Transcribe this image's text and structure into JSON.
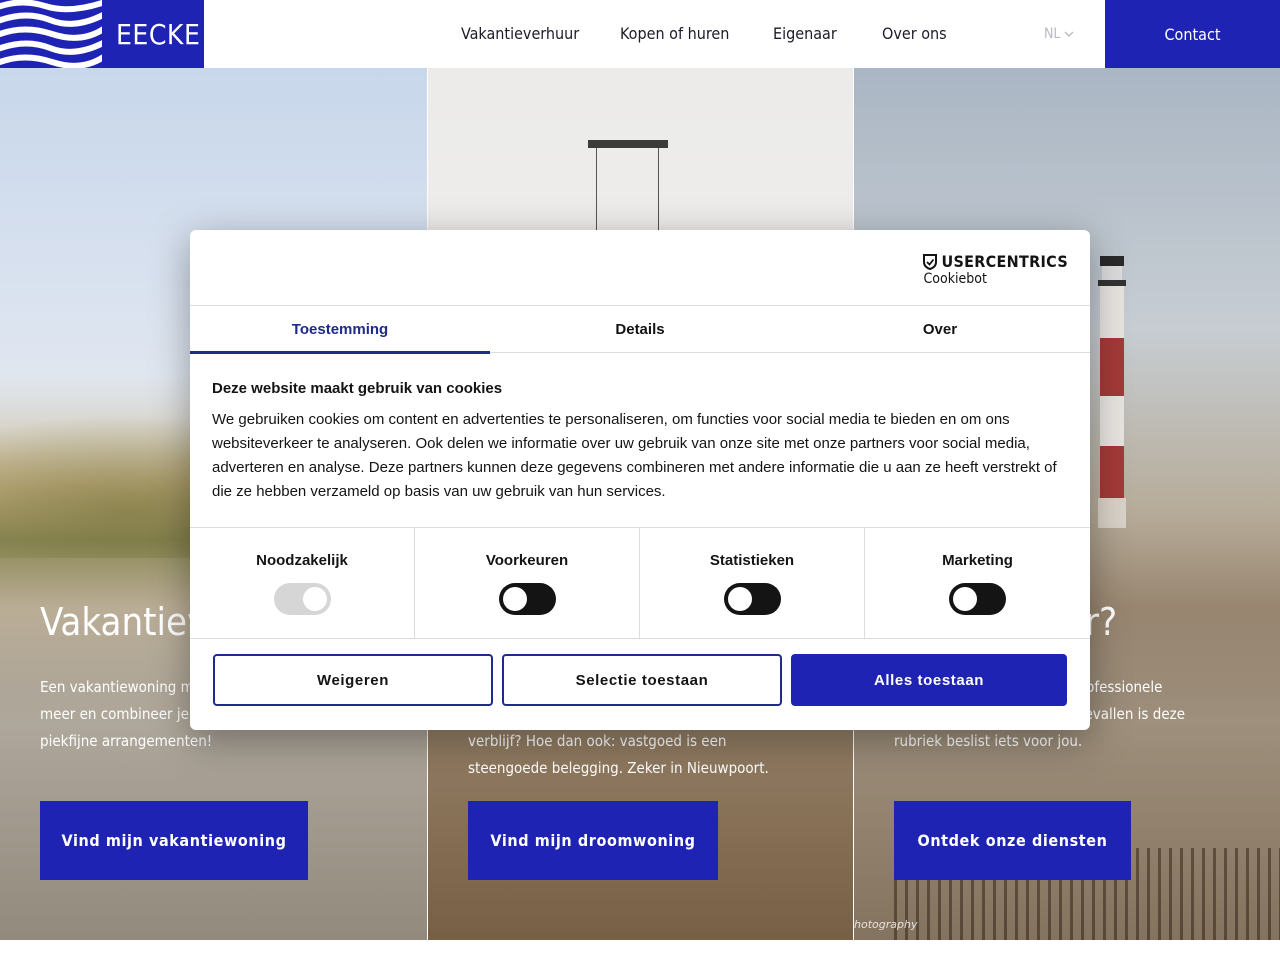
{
  "header": {
    "logo_text": "EECKE",
    "nav": [
      "Vakantieverhuur",
      "Kopen of huren",
      "Eigenaar",
      "Over ons"
    ],
    "language": "NL",
    "contact": "Contact"
  },
  "panels": [
    {
      "title": "Vakantieve",
      "text": "Een vakantiewoning me duinen? Wij hebben het meer en combineer je verblijf met een van onze piekfijne arrangementen!",
      "button": "Vind mijn vakantiewoning"
    },
    {
      "title": "",
      "text": "verblijf? Hoe dan ook: vastgoed is een steengoede belegging. Zeker in Nieuwpoort.",
      "button": "Vind mijn droomwoning"
    },
    {
      "title": "ar?",
      "text": "rd syndicus? Of wil je met professionele begeleiding? Wel, in beide gevallen is deze rubriek beslist iets voor jou.",
      "button": "Ontdek onze diensten"
    }
  ],
  "credit": "hotography",
  "cookie_dialog": {
    "brand_top": "USERCENTRICS",
    "brand_sub": "Cookiebot",
    "tabs": [
      "Toestemming",
      "Details",
      "Over"
    ],
    "active_tab": "Toestemming",
    "heading": "Deze website maakt gebruik van cookies",
    "body": "We gebruiken cookies om content en advertenties te personaliseren, om functies voor social media te bieden en om ons websiteverkeer te analyseren. Ook delen we informatie over uw gebruik van onze site met onze partners voor social media, adverteren en analyse. Deze partners kunnen deze gegevens combineren met andere informatie die u aan ze heeft verstrekt of die ze hebben verzameld op basis van uw gebruik van hun services.",
    "categories": [
      {
        "label": "Noodzakelijk",
        "enabled": true
      },
      {
        "label": "Voorkeuren",
        "enabled": false
      },
      {
        "label": "Statistieken",
        "enabled": false
      },
      {
        "label": "Marketing",
        "enabled": false
      }
    ],
    "buttons": {
      "deny": "Weigeren",
      "selection": "Selectie toestaan",
      "allow_all": "Alles toestaan"
    }
  },
  "colors": {
    "brand_blue": "#1f23b4",
    "tab_accent": "#1f2a8a"
  }
}
